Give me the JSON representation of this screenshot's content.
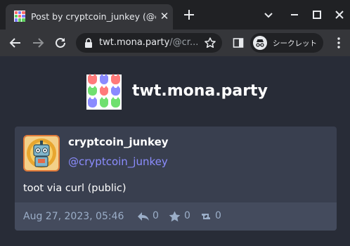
{
  "browser": {
    "tab": {
      "title": "Post by cryptcoin_junkey (@cryptcoin_junkey)",
      "close_glyph": "✕"
    },
    "omnibox": {
      "host": "twt.mona.party",
      "path": "/@cr..."
    },
    "incognito_label": "シークレット"
  },
  "site": {
    "name": "twt.mona.party",
    "logo_colors": [
      "#ff7a7a",
      "#8a8aff",
      "#ff7a7a",
      "#6fe06f",
      "#ff7a7a",
      "#8a8aff",
      "#8a8aff",
      "#6fe06f",
      "#6fe06f"
    ]
  },
  "post": {
    "display_name": "cryptcoin_junkey",
    "acct": "@cryptcoin_junkey",
    "content": "toot via curl (public)",
    "timestamp": "Aug 27, 2023, 05:46",
    "replies": "0",
    "favourites": "0",
    "reblogs": "0"
  },
  "colors": {
    "page_background": "#282c37",
    "card_background": "#393f4f",
    "footer_background": "#444b5d",
    "accent_link": "#8c8dff",
    "muted_text": "#9baec8",
    "avatar_border": "#e07a3a"
  },
  "icons": {
    "new_tab": "plus-icon",
    "back": "arrow-left-icon",
    "forward": "arrow-right-icon",
    "reload": "reload-icon",
    "secure": "lock-icon",
    "bookmark": "star-outline-icon",
    "side_panel": "side-panel-icon",
    "incognito": "incognito-icon",
    "menu": "vertical-dots-icon",
    "reply": "reply-all-icon",
    "favourite": "star-icon",
    "reblog": "retweet-icon"
  }
}
